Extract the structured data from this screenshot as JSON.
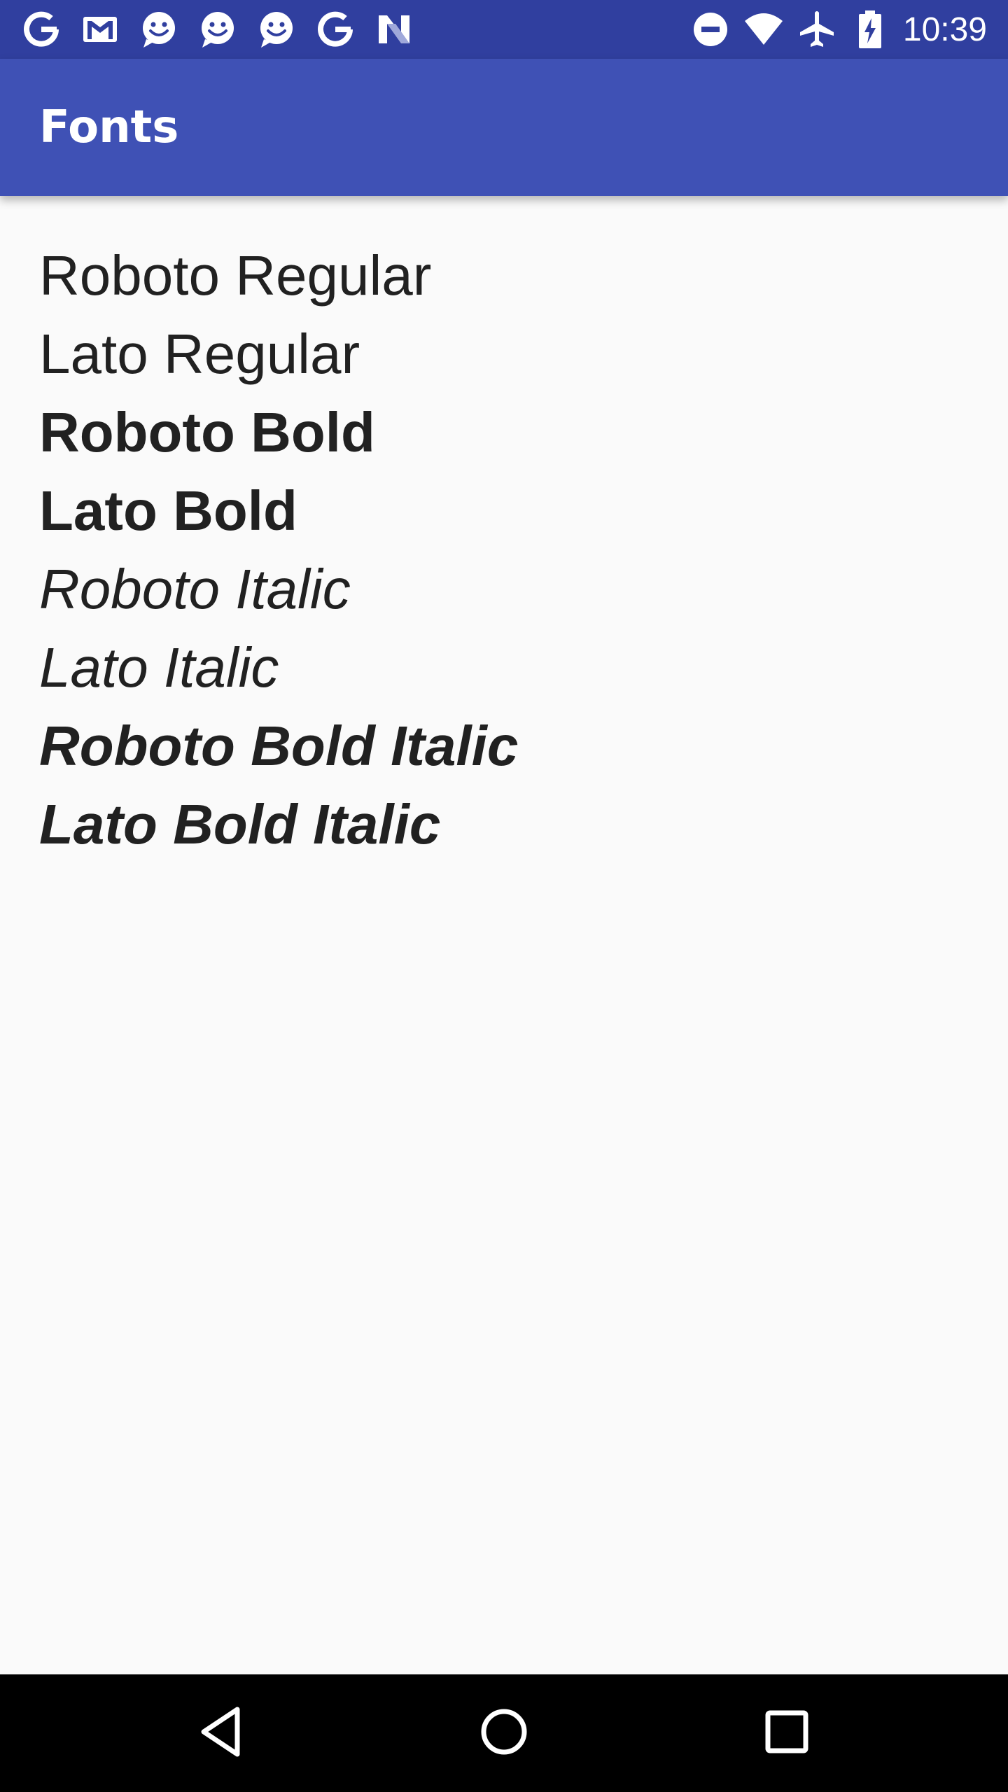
{
  "status_bar": {
    "notification_icons": [
      "google-g-icon",
      "gmail-icon",
      "chat-smiley-icon",
      "chat-smiley-icon",
      "chat-smiley-icon",
      "google-g-icon",
      "n-logo-icon"
    ],
    "system_icons": [
      "do-not-disturb-icon",
      "wifi-icon",
      "airplane-mode-icon",
      "battery-charging-icon"
    ],
    "time": "10:39"
  },
  "app_bar": {
    "title": "Fonts"
  },
  "font_samples": [
    {
      "label": "Roboto Regular",
      "weight": "regular",
      "style": "normal"
    },
    {
      "label": "Lato Regular",
      "weight": "regular",
      "style": "normal"
    },
    {
      "label": "Roboto Bold",
      "weight": "bold",
      "style": "normal"
    },
    {
      "label": "Lato Bold",
      "weight": "bold",
      "style": "normal"
    },
    {
      "label": "Roboto Italic",
      "weight": "regular",
      "style": "italic"
    },
    {
      "label": "Lato Italic",
      "weight": "regular",
      "style": "italic"
    },
    {
      "label": "Roboto Bold Italic",
      "weight": "bold",
      "style": "italic"
    },
    {
      "label": "Lato Bold Italic",
      "weight": "bold",
      "style": "italic"
    }
  ],
  "nav_bar": {
    "buttons": [
      "back-icon",
      "home-icon",
      "recents-icon"
    ]
  },
  "colors": {
    "status_bar": "#303f9f",
    "app_bar": "#3f51b5",
    "background": "#fafafa",
    "text": "#212121",
    "nav_bar": "#000000"
  }
}
